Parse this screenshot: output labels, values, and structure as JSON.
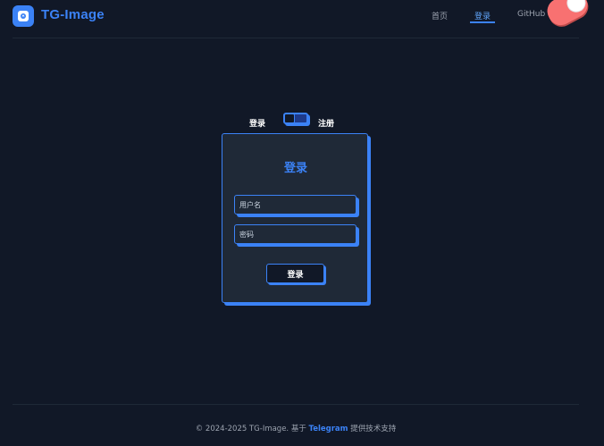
{
  "header": {
    "brand": "TG-Image",
    "logo_icon": "image-upload-icon",
    "nav": {
      "home": "首页",
      "login": "登录",
      "github": "GitHub"
    },
    "active_nav": "登录",
    "theme_toggle_icon": "theme-toggle-icon"
  },
  "auth": {
    "switch_login_label": "登录",
    "switch_register_label": "注册",
    "card_title": "登录",
    "username_placeholder": "用户名",
    "password_placeholder": "密码",
    "submit_label": "登录"
  },
  "footer": {
    "prefix": "© 2024-2025 TG-Image. 基于",
    "link": "Telegram",
    "suffix": "提供技术支持"
  },
  "colors": {
    "background": "#111827",
    "card": "#1f2937",
    "accent": "#3b82f6",
    "toggle": "#f87171"
  }
}
